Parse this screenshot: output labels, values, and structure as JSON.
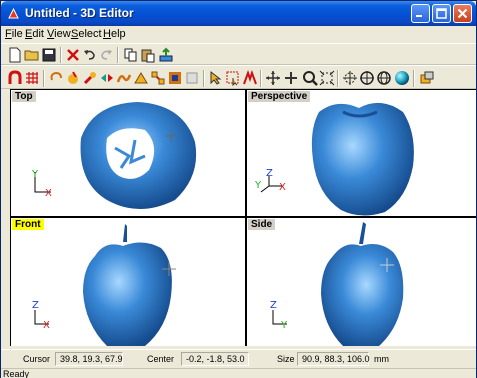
{
  "window": {
    "title": "Untitled - 3D Editor"
  },
  "menu": [
    {
      "label": "File",
      "key": "F"
    },
    {
      "label": "Edit",
      "key": "E"
    },
    {
      "label": "View",
      "key": "V"
    },
    {
      "label": "Select",
      "key": "S"
    },
    {
      "label": "Help",
      "key": "H"
    }
  ],
  "toolbar1": [
    "new-file-icon",
    "open-folder-icon",
    "save-icon",
    "delete-icon",
    "undo-icon",
    "redo-icon",
    "copy-icon",
    "paste-icon",
    "export-icon"
  ],
  "toolbar2": [
    "magnet-icon",
    "grid-icon",
    "rotate-icon",
    "paint-icon",
    "brush-icon",
    "mirror-icon",
    "smooth-icon",
    "sculpt-icon",
    "transform-icon",
    "texture-icon",
    "box-icon",
    "select-pointer-icon",
    "select-region-icon",
    "select-multi-icon",
    "pan-arrows-icon",
    "move-icon",
    "zoom-icon",
    "zoom-fit-icon",
    "center-icon",
    "target-icon",
    "orbit-icon",
    "sphere-shade-icon",
    "render-icon"
  ],
  "viewports": {
    "top": {
      "label": "Top",
      "axes": [
        "Y",
        "X"
      ]
    },
    "perspective": {
      "label": "Perspective",
      "axes": [
        "Y",
        "Z",
        "X"
      ]
    },
    "front": {
      "label": "Front",
      "axes": [
        "Z",
        "X"
      ]
    },
    "side": {
      "label": "Side",
      "axes": [
        "Z",
        "Y"
      ]
    }
  },
  "colors": {
    "model": "#3a8ad8",
    "axis_x": "#e02020",
    "axis_y": "#20b020",
    "axis_z": "#2040d0",
    "active_label": "#ffff00"
  },
  "status": {
    "cursor_label": "Cursor",
    "cursor_value": "39.8, 19.3, 67.9",
    "center_label": "Center",
    "center_value": "-0.2, -1.8, 53.0",
    "size_label": "Size",
    "size_value": "90.9, 88.3, 106.0",
    "unit": "mm",
    "ready": "Ready"
  }
}
